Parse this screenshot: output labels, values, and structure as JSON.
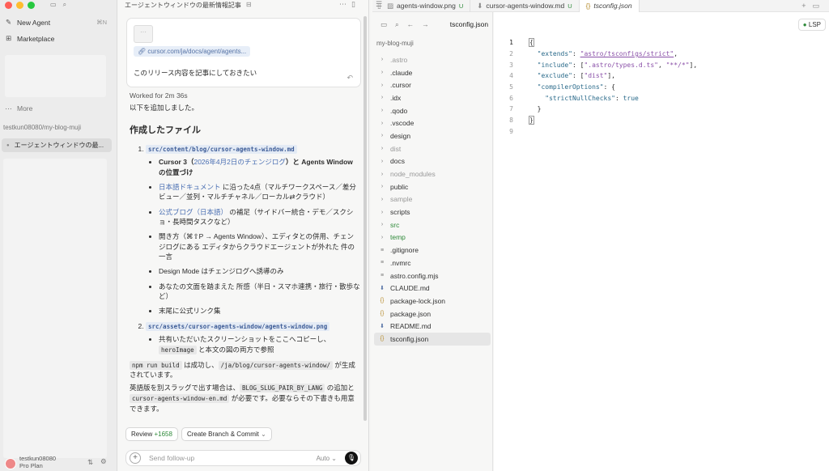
{
  "sidebar": {
    "new_agent": "New Agent",
    "new_agent_shortcut": "⌘N",
    "marketplace": "Marketplace",
    "more": "More",
    "project": "testkun08080/my-blog-muji",
    "active_chat": "エージェントウィンドウの最...",
    "user_name": "testkun08080",
    "plan": "Pro Plan"
  },
  "chat": {
    "title": "エージェントウィンドウの最新情報記事",
    "card": {
      "url": "cursor.com/ja/docs/agent/agents...",
      "text": "このリリース内容を記事にしておきたい"
    },
    "worked": "Worked for 2m 36s",
    "added": "以下を追加しました。",
    "section_title": "作成したファイル",
    "file1": "src/content/blog/cursor-agents-window.md",
    "file1_bullets": {
      "b1_a": "Cursor 3（",
      "b1_link": "2026年4月2日のチェンジログ",
      "b1_b": "）と Agents Window の位置づけ",
      "b2_link": "日本語ドキュメント",
      "b2_rest": " に沿った4点（マルチワークスペース／差分ビュー／並列・マルチチャネル／ローカル⇄クラウド）",
      "b3_link": "公式ブログ（日本語）",
      "b3_rest": " の補足（サイドバー統合・デモ／スクショ・長時間タスクなど）",
      "b4": "開き方（⌘⇧P → Agents Window）、エディタとの併用、チェンジログにある エディタからクラウドエージェントが外れた 件の一言",
      "b5": "Design Mode はチェンジログへ誘導のみ",
      "b6": "あなたの文面を踏まえた 所感（半日・スマホ連携・旅行・散歩など）",
      "b7": "末尾に公式リンク集"
    },
    "file2": "src/assets/cursor-agents-window/agents-window.png",
    "file2_bullet_a": "共有いただいたスクリーンショットをここへコピーし、",
    "file2_bullet_code": "heroImage",
    "file2_bullet_b": " と本文の図の両方で参照",
    "build_code1": "npm run build",
    "build_mid": " は成功し、",
    "build_code2": "/ja/blog/cursor-agents-window/",
    "build_end": " が生成されています。",
    "en_a": "英語版を別スラッグで出す場合は、",
    "en_code1": "BLOG_SLUG_PAIR_BY_LANG",
    "en_mid": " の追加と ",
    "en_code2": "cursor-agents-window-en.md",
    "en_end": " が必要です。必要ならその下書きも用意できます。",
    "review_label": "Review",
    "review_count": "+1658",
    "branch_label": "Create Branch & Commit",
    "input_placeholder": "Send follow-up",
    "mode": "Auto"
  },
  "explorer": {
    "root": "my-blog-muji",
    "items": [
      {
        "name": ".astro",
        "type": "folder",
        "style": "dim"
      },
      {
        "name": ".claude",
        "type": "folder",
        "style": ""
      },
      {
        "name": ".cursor",
        "type": "folder",
        "style": ""
      },
      {
        "name": ".idx",
        "type": "folder",
        "style": ""
      },
      {
        "name": ".qodo",
        "type": "folder",
        "style": ""
      },
      {
        "name": ".vscode",
        "type": "folder",
        "style": ""
      },
      {
        "name": "design",
        "type": "folder",
        "style": ""
      },
      {
        "name": "dist",
        "type": "folder",
        "style": "dim"
      },
      {
        "name": "docs",
        "type": "folder",
        "style": ""
      },
      {
        "name": "node_modules",
        "type": "folder",
        "style": "dim"
      },
      {
        "name": "public",
        "type": "folder",
        "style": ""
      },
      {
        "name": "sample",
        "type": "folder",
        "style": "dim"
      },
      {
        "name": "scripts",
        "type": "folder",
        "style": ""
      },
      {
        "name": "src",
        "type": "folder",
        "style": "green"
      },
      {
        "name": "temp",
        "type": "folder",
        "style": "green"
      },
      {
        "name": ".gitignore",
        "type": "file",
        "style": ""
      },
      {
        "name": ".nvmrc",
        "type": "file",
        "style": ""
      },
      {
        "name": "astro.config.mjs",
        "type": "file",
        "style": ""
      },
      {
        "name": "CLAUDE.md",
        "type": "md",
        "style": ""
      },
      {
        "name": "package-lock.json",
        "type": "json",
        "style": ""
      },
      {
        "name": "package.json",
        "type": "json",
        "style": ""
      },
      {
        "name": "README.md",
        "type": "md",
        "style": ""
      },
      {
        "name": "tsconfig.json",
        "type": "json",
        "style": "sel"
      }
    ]
  },
  "editor": {
    "tabs": [
      {
        "name": "agents-window.png",
        "badge": "U",
        "active": false
      },
      {
        "name": "cursor-agents-window.md",
        "badge": "U",
        "active": false
      },
      {
        "name": "tsconfig.json",
        "badge": "",
        "active": true
      }
    ],
    "breadcrumb": "tsconfig.json",
    "lsp": "LSP",
    "lines": [
      "1",
      "2",
      "3",
      "4",
      "5",
      "6",
      "7",
      "8",
      "9"
    ]
  },
  "colors": {
    "traffic_red": "#ff5f57",
    "traffic_yellow": "#febc2e",
    "traffic_green": "#28c840",
    "accent_green": "#2f8a3a",
    "link_blue": "#4a6fb3"
  }
}
